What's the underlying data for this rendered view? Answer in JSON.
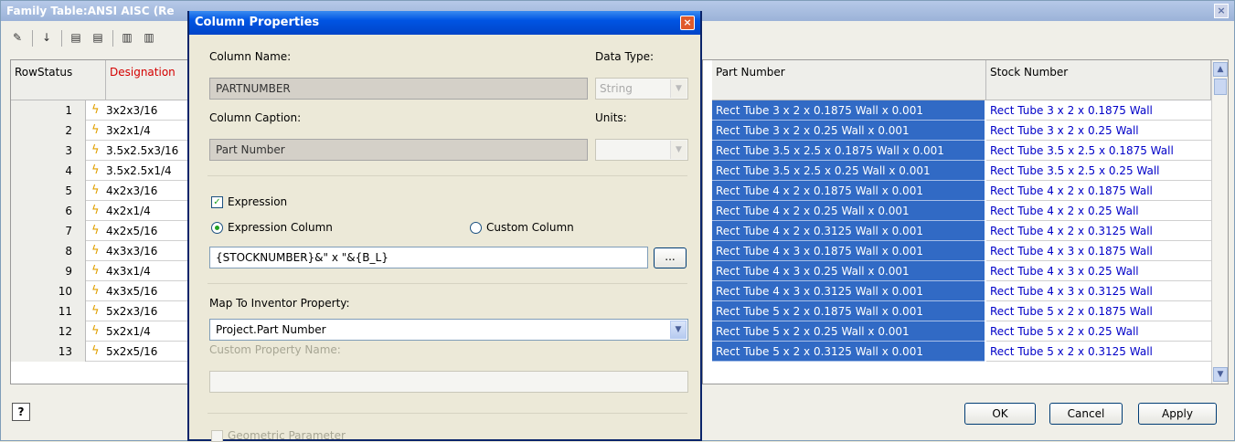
{
  "main": {
    "title": "Family Table:ANSI AISC (Re",
    "close_glyph": "×",
    "toolbar": {
      "edit_glyph": "✎",
      "sort_glyph": "↓",
      "tb3": "▤",
      "tb4": "▤",
      "tb5": "▥",
      "tb6": "▥"
    },
    "headers": {
      "row_status": "RowStatus",
      "designation": "Designation",
      "part_number": "Part Number",
      "stock_number": "Stock Number"
    },
    "designation_color": "#d40000",
    "bolt_glyph": "ϟ",
    "rows": [
      {
        "num": "1",
        "designation": "3x2x3/16",
        "part_number": "Rect Tube 3 x 2 x 0.1875 Wall x 0.001",
        "stock_number": "Rect Tube 3 x 2 x 0.1875 Wall"
      },
      {
        "num": "2",
        "designation": "3x2x1/4",
        "part_number": "Rect Tube 3 x 2 x 0.25 Wall x 0.001",
        "stock_number": "Rect Tube 3 x 2 x 0.25 Wall"
      },
      {
        "num": "3",
        "designation": "3.5x2.5x3/16",
        "part_number": "Rect Tube 3.5 x 2.5 x 0.1875 Wall x 0.001",
        "stock_number": "Rect Tube 3.5 x 2.5 x 0.1875 Wall"
      },
      {
        "num": "4",
        "designation": "3.5x2.5x1/4",
        "part_number": "Rect Tube 3.5 x 2.5 x 0.25 Wall x 0.001",
        "stock_number": "Rect Tube 3.5 x 2.5 x 0.25 Wall"
      },
      {
        "num": "5",
        "designation": "4x2x3/16",
        "part_number": "Rect Tube 4 x 2 x 0.1875 Wall x 0.001",
        "stock_number": "Rect Tube 4 x 2 x 0.1875 Wall"
      },
      {
        "num": "6",
        "designation": "4x2x1/4",
        "part_number": "Rect Tube 4 x 2 x 0.25 Wall x 0.001",
        "stock_number": "Rect Tube 4 x 2 x 0.25 Wall"
      },
      {
        "num": "7",
        "designation": "4x2x5/16",
        "part_number": "Rect Tube 4 x 2 x 0.3125 Wall x 0.001",
        "stock_number": "Rect Tube 4 x 2 x 0.3125 Wall"
      },
      {
        "num": "8",
        "designation": "4x3x3/16",
        "part_number": "Rect Tube 4 x 3 x 0.1875 Wall x 0.001",
        "stock_number": "Rect Tube 4 x 3 x 0.1875 Wall"
      },
      {
        "num": "9",
        "designation": "4x3x1/4",
        "part_number": "Rect Tube 4 x 3 x 0.25 Wall x 0.001",
        "stock_number": "Rect Tube 4 x 3 x 0.25 Wall"
      },
      {
        "num": "10",
        "designation": "4x3x5/16",
        "part_number": "Rect Tube 4 x 3 x 0.3125 Wall x 0.001",
        "stock_number": "Rect Tube 4 x 3 x 0.3125 Wall"
      },
      {
        "num": "11",
        "designation": "5x2x3/16",
        "part_number": "Rect Tube 5 x 2 x 0.1875 Wall x 0.001",
        "stock_number": "Rect Tube 5 x 2 x 0.1875 Wall"
      },
      {
        "num": "12",
        "designation": "5x2x1/4",
        "part_number": "Rect Tube 5 x 2 x 0.25 Wall x 0.001",
        "stock_number": "Rect Tube 5 x 2 x 0.25 Wall"
      },
      {
        "num": "13",
        "designation": "5x2x5/16",
        "part_number": "Rect Tube 5 x 2 x 0.3125 Wall x 0.001",
        "stock_number": "Rect Tube 5 x 2 x 0.3125 Wall"
      }
    ],
    "scroll_up_glyph": "▲",
    "scroll_down_glyph": "▼",
    "help_glyph": "?",
    "ok_label": "OK",
    "cancel_label": "Cancel",
    "apply_label": "Apply",
    "selection_color": "#316ac5",
    "stock_text_color": "#0000c8"
  },
  "dialog": {
    "title": "Column Properties",
    "close_glyph": "×",
    "column_name_label": "Column Name:",
    "column_name_value": "PARTNUMBER",
    "data_type_label": "Data Type:",
    "data_type_value": "String",
    "column_caption_label": "Column Caption:",
    "column_caption_value": "Part Number",
    "units_label": "Units:",
    "units_value": "",
    "expression_label": "Expression",
    "expression_checked": true,
    "expression_column_label": "Expression Column",
    "custom_column_label": "Custom Column",
    "expression_value": "{STOCKNUMBER}&\" x \"&{B_L}",
    "browse_label": "...",
    "map_label": "Map To Inventor Property:",
    "map_value": "Project.Part Number",
    "custom_property_label": "Custom Property Name:",
    "custom_property_value": "",
    "geometric_label": "Geometric Parameter",
    "combo_arrow_glyph": "▼",
    "check_glyph": "✓",
    "title_color": "#0054e3"
  }
}
